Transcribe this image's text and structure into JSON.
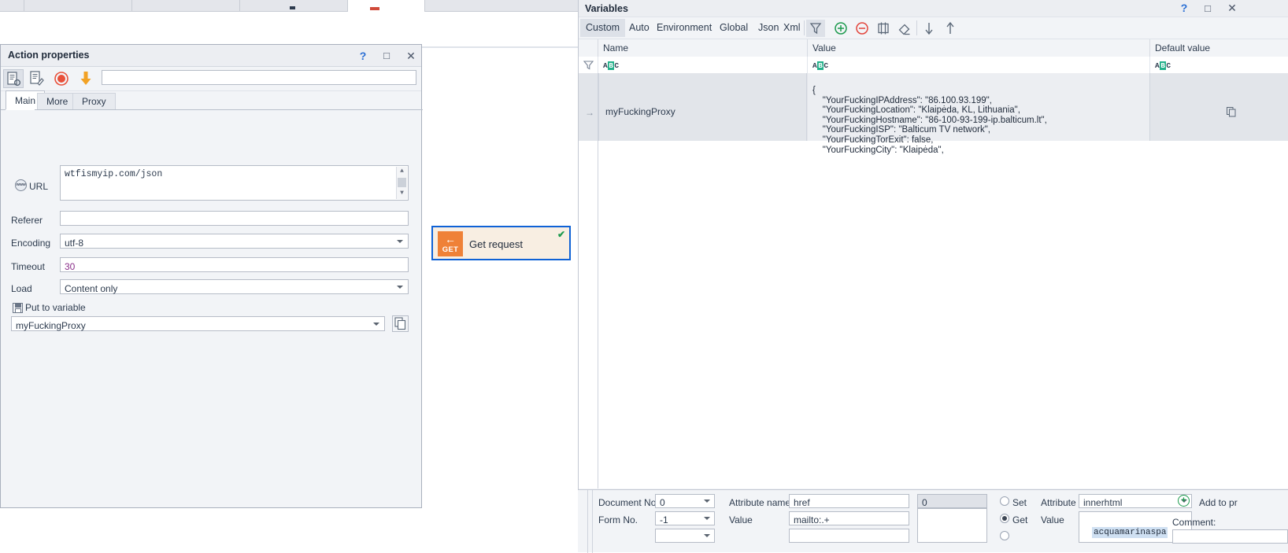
{
  "action_window": {
    "title": "Action properties",
    "buttons": {
      "help": "?",
      "maximize": "□",
      "close": "✕"
    },
    "toolbar": {
      "input_value": "",
      "icons": [
        "document-settings-icon",
        "document-edit-icon",
        "record-icon",
        "download-arrow-icon"
      ]
    },
    "tabs": [
      {
        "label": "Main",
        "active": true
      },
      {
        "label": "More",
        "active": false
      },
      {
        "label": "Proxy",
        "active": false
      }
    ],
    "fields": {
      "url_label": "URL",
      "url_value": "wtfismyip.com/json",
      "referer_label": "Referer",
      "referer_value": "",
      "encoding_label": "Encoding",
      "encoding_value": "utf-8",
      "timeout_label": "Timeout",
      "timeout_value": "30",
      "load_label": "Load",
      "load_value": "Content only",
      "put_to_variable_label": "Put to variable",
      "put_to_variable_value": "myFuckingProxy"
    }
  },
  "flow_node": {
    "icon_arrow": "←",
    "icon_method": "GET",
    "label": "Get request",
    "status_check": "✔"
  },
  "variables_panel": {
    "title": "Variables",
    "buttons": {
      "help": "?",
      "maximize": "□",
      "close": "✕"
    },
    "tabs": [
      {
        "label": "Custom",
        "active": true
      },
      {
        "label": "Auto",
        "active": false
      },
      {
        "label": "Environment",
        "active": false
      },
      {
        "label": "Global",
        "active": false
      },
      {
        "label": "Json",
        "active": false
      },
      {
        "label": "Xml",
        "active": false
      }
    ],
    "toolbar_icons": [
      "filter-icon",
      "add-icon",
      "remove-icon",
      "columns-icon",
      "eraser-icon",
      "move-down-icon",
      "move-up-icon"
    ],
    "columns": [
      "Name",
      "Value",
      "Default value"
    ],
    "filter_row": {
      "name": "ABC",
      "value": "ABC",
      "default": "ABC"
    },
    "rows": [
      {
        "selector": "→",
        "name": "myFuckingProxy",
        "value": "{\n    \"YourFuckingIPAddress\": \"86.100.93.199\",\n    \"YourFuckingLocation\": \"Klaipėda, KL, Lithuania\",\n    \"YourFuckingHostname\": \"86-100-93-199-ip.balticum.lt\",\n    \"YourFuckingISP\": \"Balticum TV network\",\n    \"YourFuckingTorExit\": false,\n    \"YourFuckingCity\": \"Klaipėda\",",
        "default_value": ""
      }
    ]
  },
  "bottom_strip": {
    "document_no_label": "Document No.",
    "document_no_value": "0",
    "form_no_label": "Form No.",
    "form_no_value": "-1",
    "attribute_name_label": "Attribute name",
    "attribute_name_value": "href",
    "value_label": "Value",
    "value_value": "mailto:.+",
    "index_value": "0",
    "set_label": "Set",
    "get_label": "Get",
    "attribute_label": "Attribute",
    "attribute_value": "innerhtml",
    "attr_value_label": "Value",
    "attr_value_text": "acquamarinaspa",
    "add_to_project_label": "Add to pr",
    "comment_label": "Comment:"
  }
}
